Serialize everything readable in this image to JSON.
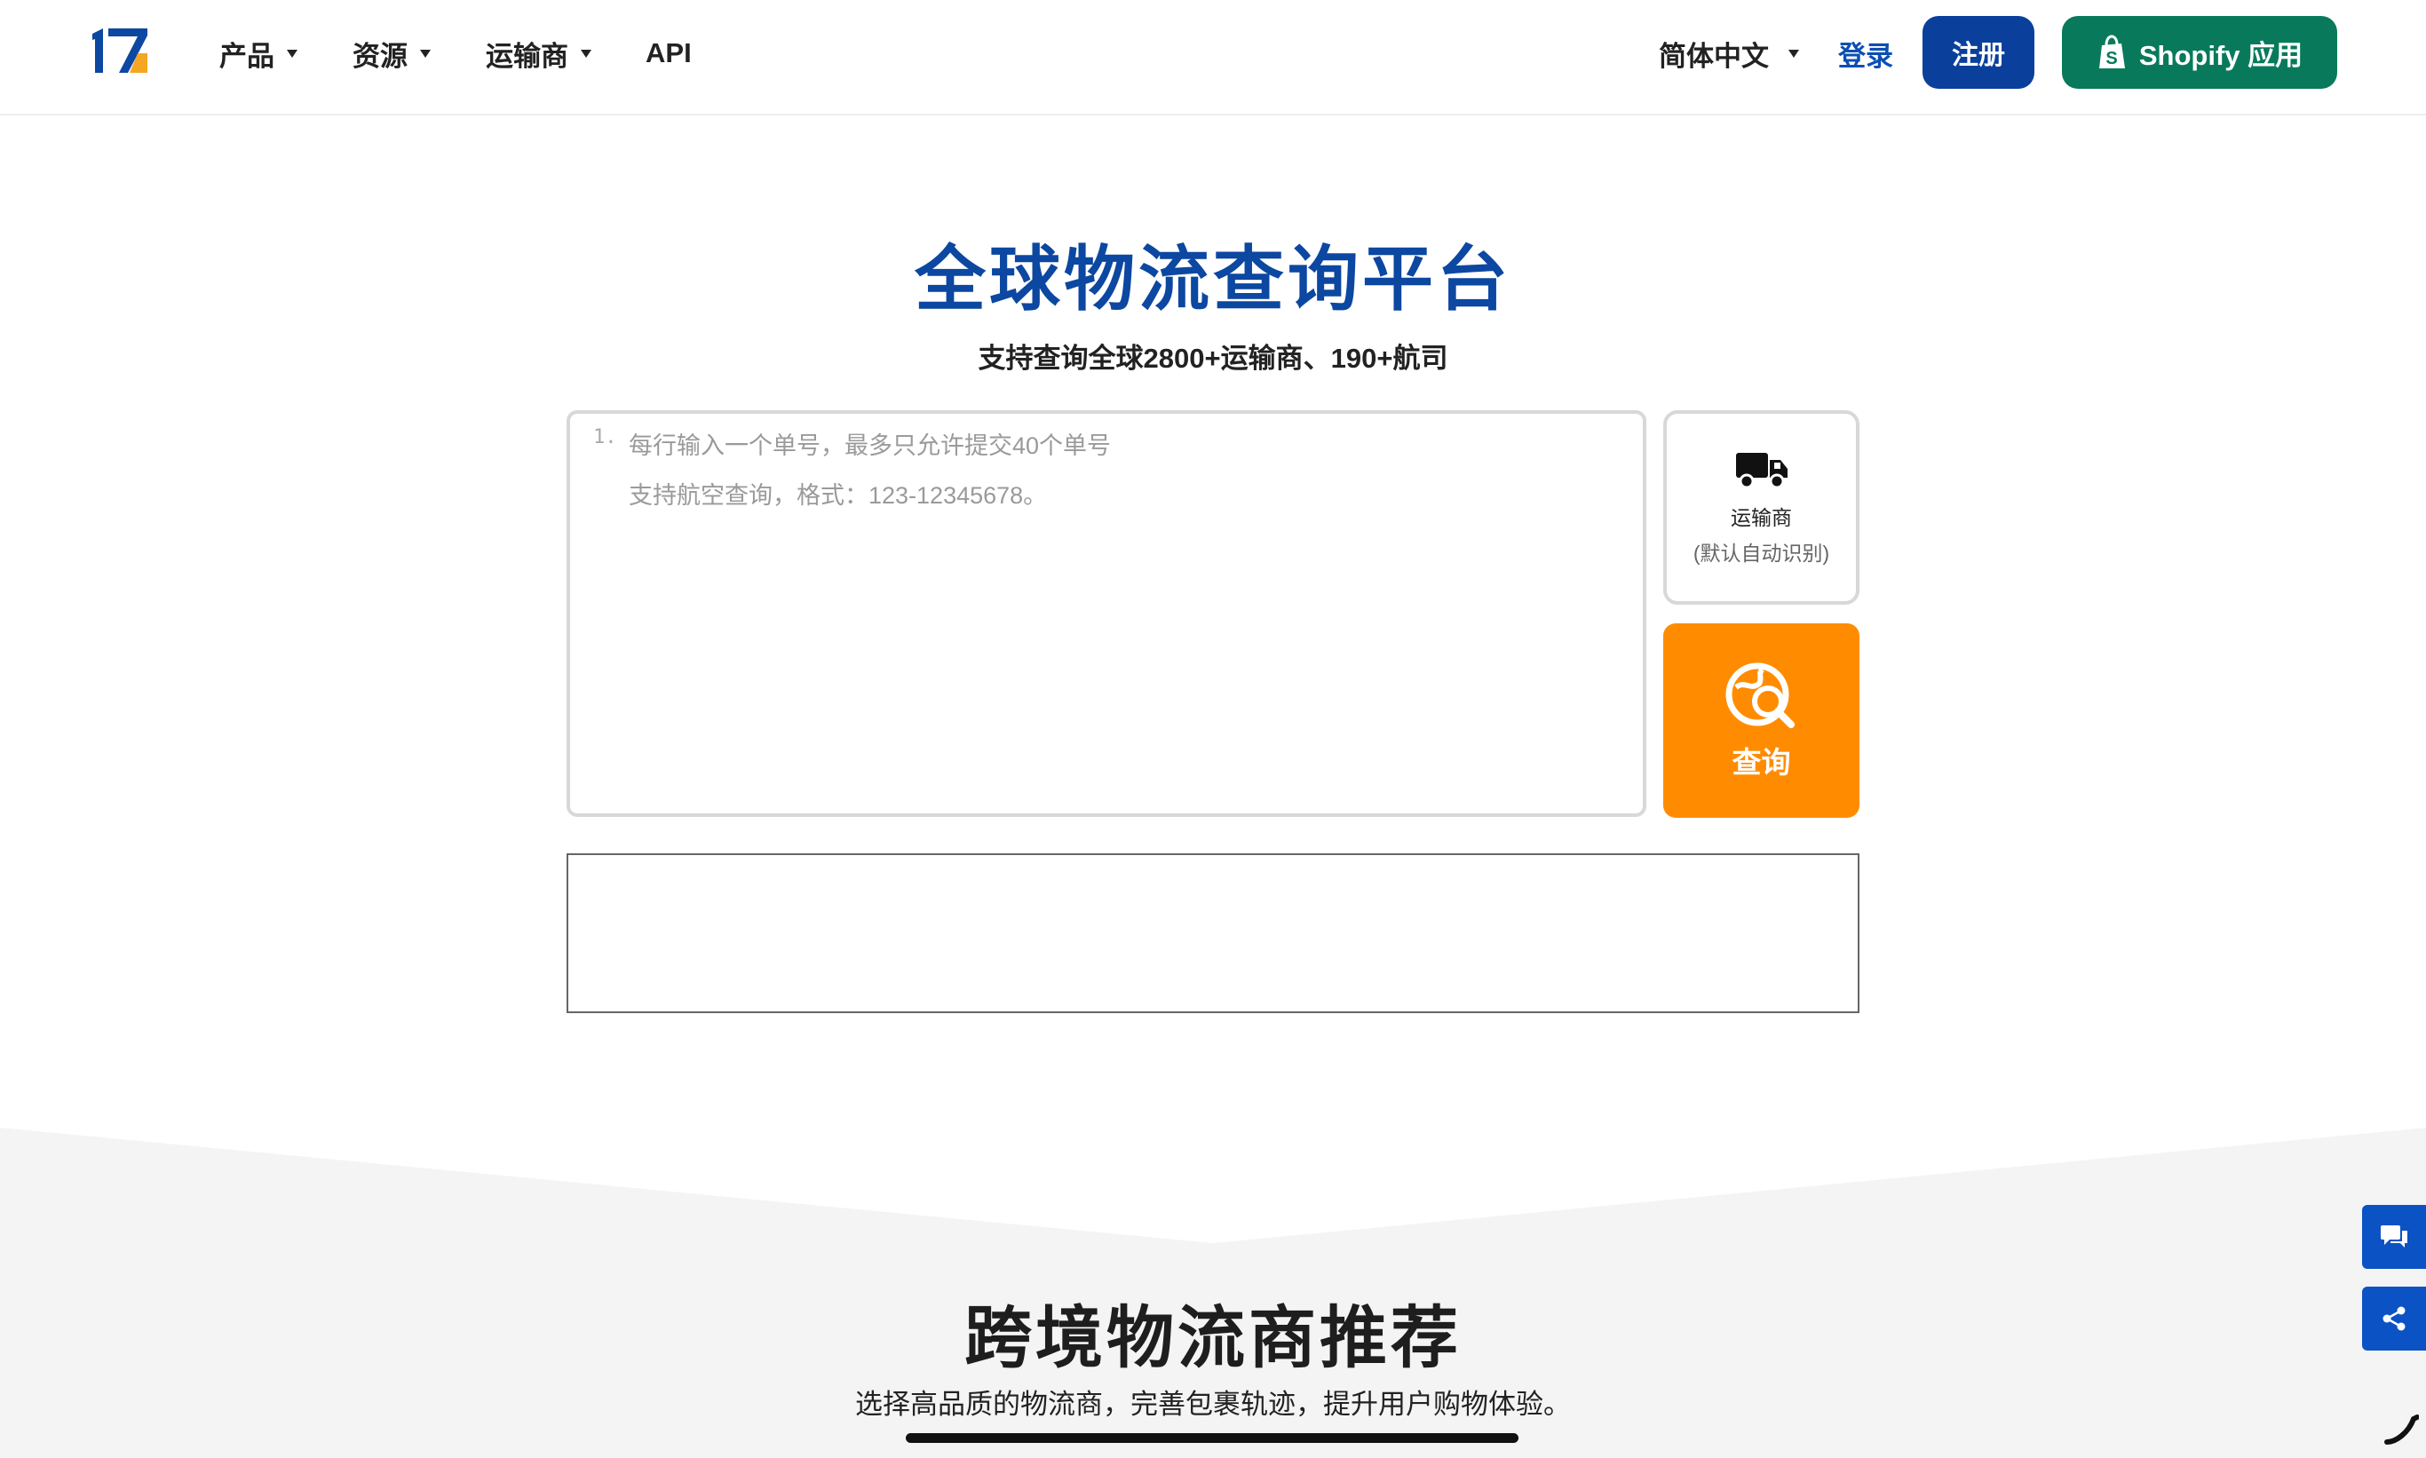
{
  "header": {
    "logo_text": "17",
    "nav": [
      {
        "label": "产品",
        "has_menu": true
      },
      {
        "label": "资源",
        "has_menu": true
      },
      {
        "label": "运输商",
        "has_menu": true
      },
      {
        "label": "API",
        "has_menu": false
      }
    ],
    "language": "简体中文",
    "login": "登录",
    "register": "注册",
    "shopify": "Shopify 应用"
  },
  "hero": {
    "title": "全球物流查询平台",
    "subtitle": "支持查询全球2800+运输商、190+航司"
  },
  "tracking": {
    "line_number": "1.",
    "placeholder_line1": "每行输入一个单号，最多只允许提交40个单号",
    "placeholder_line2": "支持航空查询，格式：123-12345678。",
    "carrier_label": "运输商",
    "carrier_hint": "(默认自动识别)",
    "search_label": "查询"
  },
  "recommend": {
    "title": "跨境物流商推荐",
    "subtitle": "选择高品质的物流商，完善包裹轨迹，提升用户购物体验。"
  },
  "colors": {
    "brand_blue": "#0c47a1",
    "register_bg": "#0a3f9c",
    "shopify_green": "#087a5b",
    "search_orange": "#ff8c00",
    "side_button_blue": "#0b52c4"
  },
  "icons": {
    "carrier": "truck-icon",
    "search": "search-globe-icon",
    "shopify": "shopify-bag-icon",
    "side_1": "chat-icon",
    "side_2": "share-icon"
  }
}
